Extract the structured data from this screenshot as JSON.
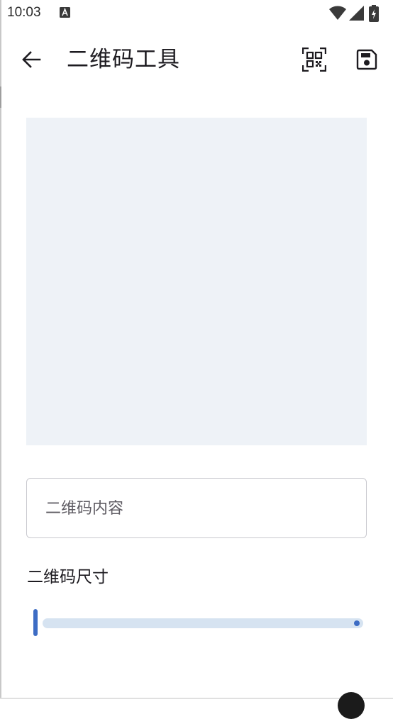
{
  "status_bar": {
    "time": "10:03",
    "notification_icon": "text-a-icon",
    "icons": [
      "wifi-icon",
      "signal-icon",
      "battery-charging-icon"
    ]
  },
  "app_bar": {
    "title": "二维码工具",
    "back_icon": "arrow-left-icon",
    "actions": [
      "qr-scan-icon",
      "save-icon"
    ]
  },
  "preview": {
    "background": "#eef2f7"
  },
  "content_field": {
    "placeholder": "二维码内容",
    "value": ""
  },
  "size": {
    "label": "二维码尺寸",
    "slider_fraction": 0.0
  },
  "colors": {
    "accent": "#3d6cc4",
    "track": "#d6e3f1"
  }
}
